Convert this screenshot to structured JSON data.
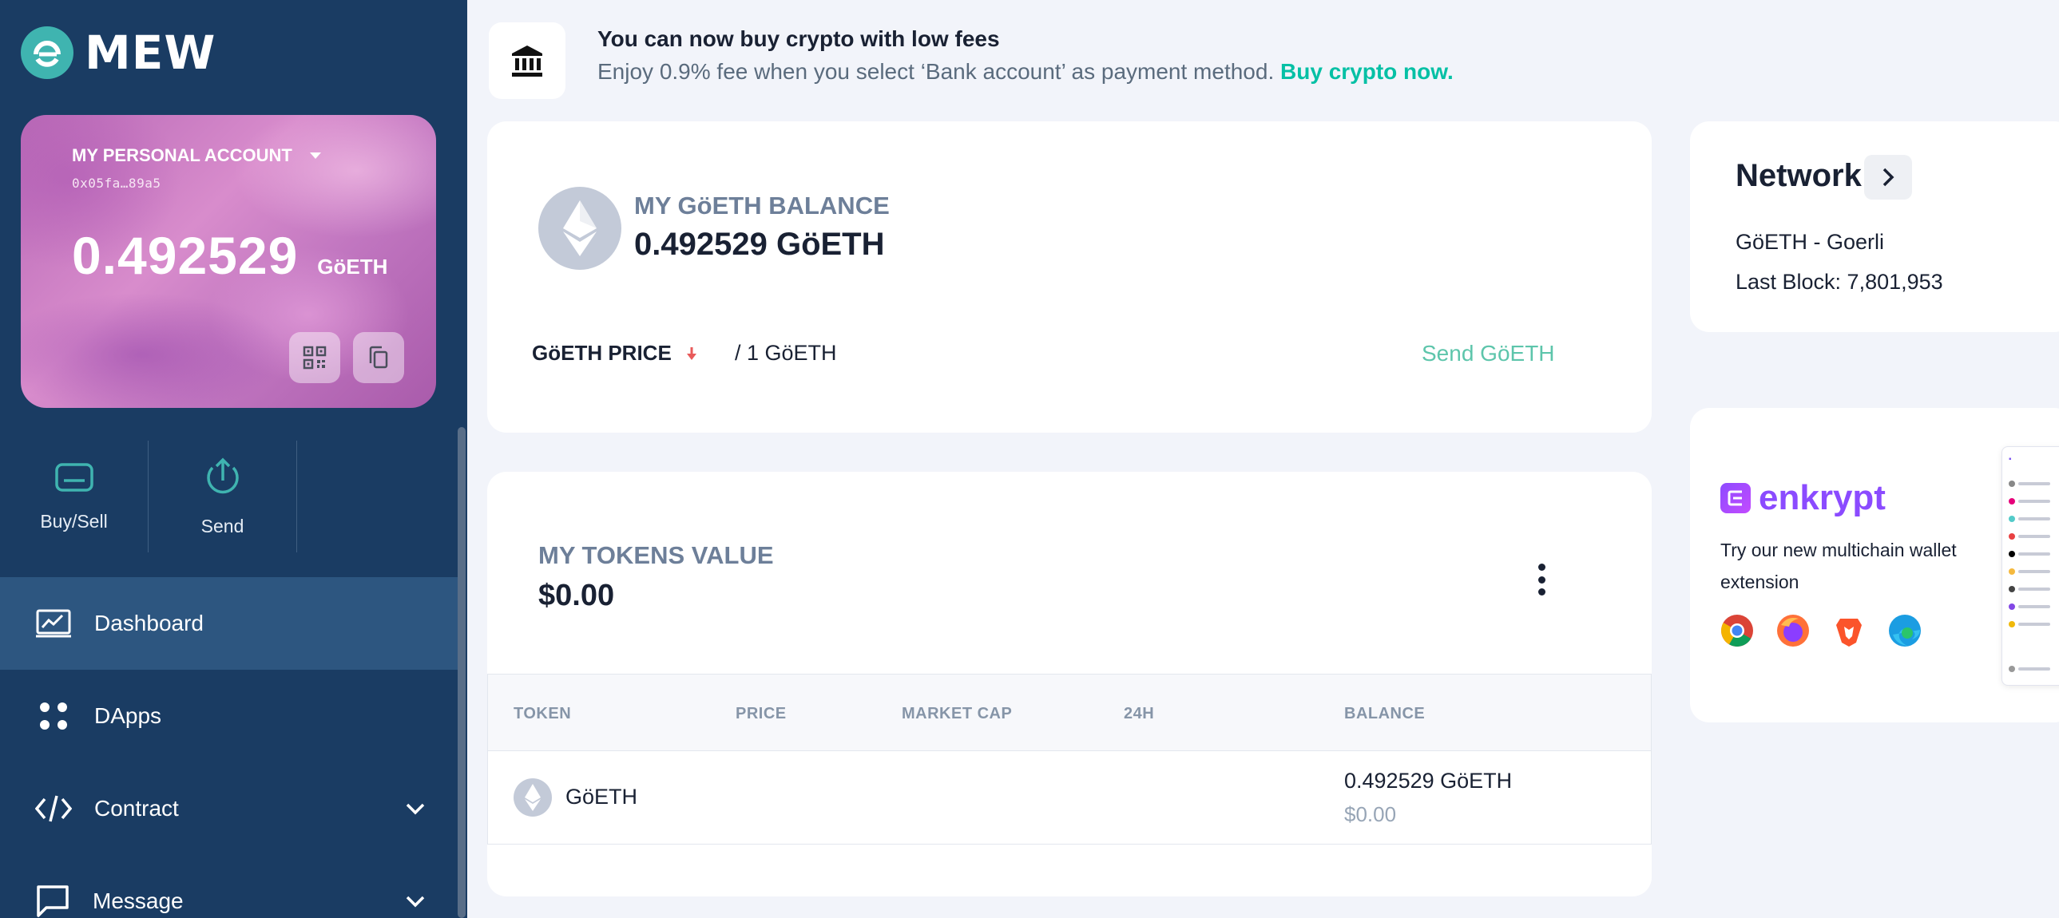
{
  "sidebar": {
    "logo_text": "MEW",
    "wallet": {
      "account_name": "MY PERSONAL ACCOUNT",
      "address": "0x05fa…89a5",
      "balance": "0.492529",
      "unit": "GöETH"
    },
    "quick_actions": [
      {
        "label": "Buy/Sell",
        "icon": "card-icon"
      },
      {
        "label": "Send",
        "icon": "send-arrow-icon"
      }
    ],
    "nav": [
      {
        "label": "Dashboard",
        "icon": "dashboard-icon",
        "active": true
      },
      {
        "label": "DApps",
        "icon": "dapps-icon"
      },
      {
        "label": "Contract",
        "icon": "code-icon"
      },
      {
        "label": "Message",
        "icon": "message-icon"
      }
    ]
  },
  "banner": {
    "icon": "bank-icon",
    "title": "You can now buy crypto with low fees",
    "text": "Enjoy 0.9% fee when you select ‘Bank account’ as payment method.",
    "link": "Buy crypto now."
  },
  "balance": {
    "label": "MY GöETH BALANCE",
    "value": "0.492529 GöETH",
    "price_label": "GöETH PRICE",
    "price_per": "/ 1 GöETH",
    "send_link": "Send GöETH",
    "colors": {
      "send": "#5dc5ab",
      "down_arrow": "#e85a5a"
    }
  },
  "tokens": {
    "label": "MY TOKENS VALUE",
    "value": "$0.00",
    "columns": [
      "TOKEN",
      "PRICE",
      "MARKET CAP",
      "24H",
      "BALANCE"
    ],
    "rows": [
      {
        "token": "GöETH",
        "price": "",
        "market_cap": "",
        "change_24h": "",
        "balance": "0.492529 GöETH",
        "balance_usd": "$0.00"
      }
    ]
  },
  "network": {
    "title": "Network",
    "name": "GöETH - Goerli",
    "last_block": "Last Block: 7,801,953"
  },
  "enkrypt": {
    "name": "enkrypt",
    "text": "Try our new multichain wallet extension",
    "browsers": [
      "chrome-icon",
      "firefox-icon",
      "brave-icon",
      "edge-icon"
    ]
  }
}
